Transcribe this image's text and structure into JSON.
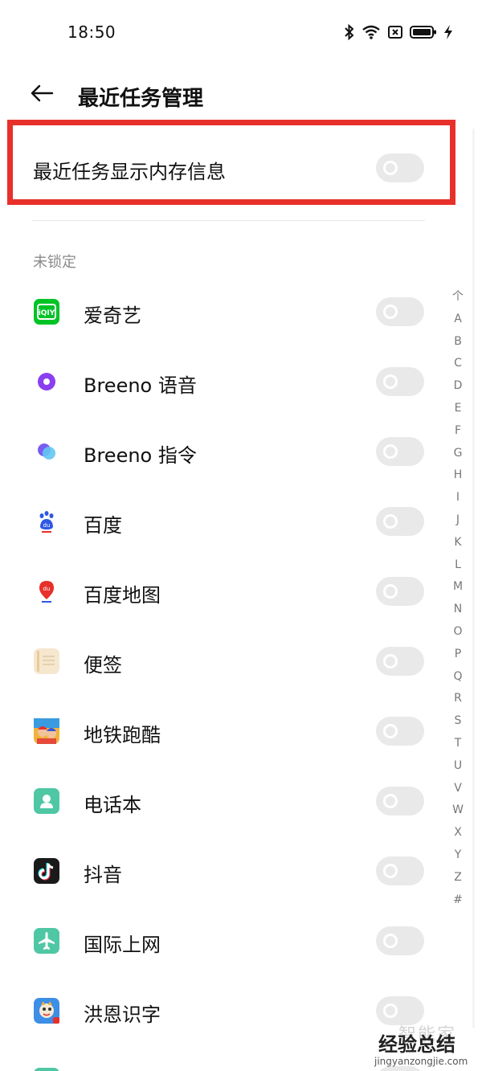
{
  "status_bar": {
    "time": "18:50",
    "icons": [
      "bluetooth-icon",
      "wifi-icon",
      "sim-icon",
      "battery-icon",
      "charging-icon"
    ]
  },
  "header": {
    "back_icon": "arrow-left-icon",
    "title": "最近任务管理"
  },
  "memory_setting": {
    "label": "最近任务显示内存信息",
    "enabled": false
  },
  "section": {
    "title": "未锁定"
  },
  "apps": [
    {
      "name": "爱奇艺",
      "icon": "iqiyi-icon",
      "color": "#00c326",
      "locked": false
    },
    {
      "name": "Breeno 语音",
      "icon": "breeno-voice-icon",
      "color": "#7b3ff2",
      "locked": false
    },
    {
      "name": "Breeno 指令",
      "icon": "breeno-command-icon",
      "color": "#5aa9f5",
      "locked": false
    },
    {
      "name": "百度",
      "icon": "baidu-icon",
      "color": "#2f57e4",
      "locked": false
    },
    {
      "name": "百度地图",
      "icon": "baidu-map-icon",
      "color": "#e8302b",
      "locked": false
    },
    {
      "name": "便签",
      "icon": "notes-icon",
      "color": "#f6e7cf",
      "locked": false
    },
    {
      "name": "地铁跑酷",
      "icon": "subway-surfers-icon",
      "color": "#e54a3a",
      "locked": false
    },
    {
      "name": "电话本",
      "icon": "contacts-icon",
      "color": "#4fc7a4",
      "locked": false
    },
    {
      "name": "抖音",
      "icon": "douyin-icon",
      "color": "#1a1a1a",
      "locked": false
    },
    {
      "name": "国际上网",
      "icon": "airplane-icon",
      "color": "#4fc7a4",
      "locked": false
    },
    {
      "name": "洪恩识字",
      "icon": "hongen-icon",
      "color": "#3d8ee6",
      "locked": false
    }
  ],
  "index_letters": [
    "个",
    "A",
    "B",
    "C",
    "D",
    "E",
    "F",
    "G",
    "H",
    "I",
    "J",
    "K",
    "L",
    "M",
    "N",
    "O",
    "P",
    "Q",
    "R",
    "S",
    "T",
    "U",
    "V",
    "W",
    "X",
    "Y",
    "Z",
    "#"
  ],
  "watermark": {
    "top": "智能家",
    "main": "经验总结",
    "url": "jingyanzongjie.com"
  },
  "colors": {
    "highlight": "#e8302b",
    "toggle_off": "#e9e9e9"
  }
}
